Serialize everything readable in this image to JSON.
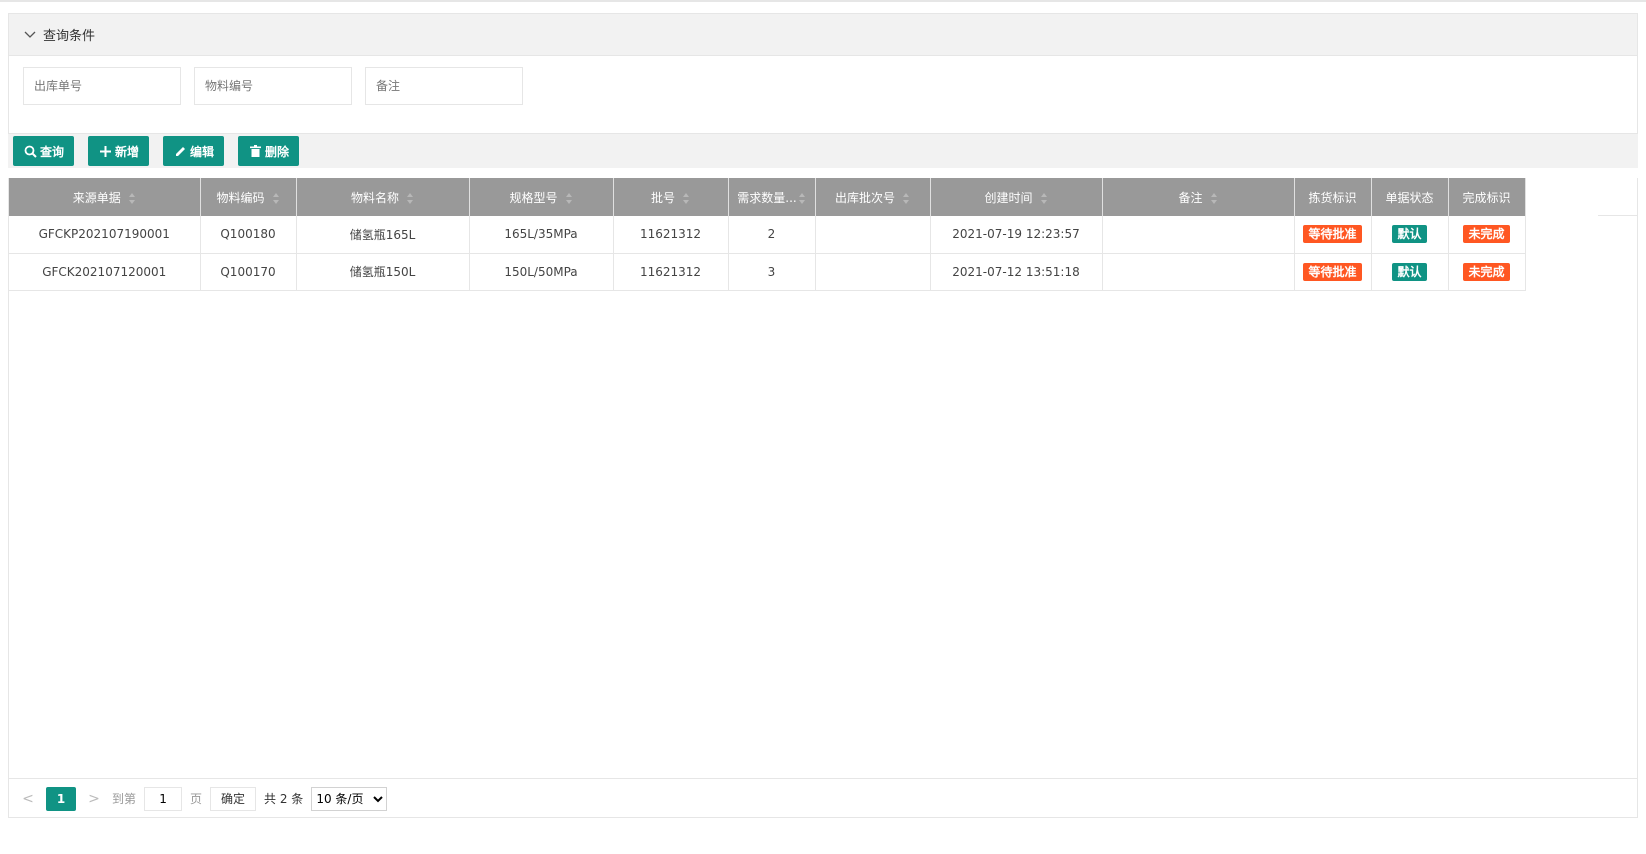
{
  "query": {
    "title": "查询条件",
    "fields": [
      {
        "placeholder": "出库单号",
        "value": ""
      },
      {
        "placeholder": "物料编号",
        "value": ""
      },
      {
        "placeholder": "备注",
        "value": ""
      }
    ]
  },
  "toolbar": {
    "query_label": "查询",
    "add_label": "新增",
    "edit_label": "编辑",
    "delete_label": "删除"
  },
  "table": {
    "columns": [
      "来源单据",
      "物料编码",
      "物料名称",
      "规格型号",
      "批号",
      "需求数量...",
      "出库批次号",
      "创建时间",
      "备注",
      "拣货标识",
      "单据状态",
      "完成标识"
    ],
    "rows": [
      {
        "source": "GFCKP202107190001",
        "code": "Q100180",
        "name": "储氢瓶165L",
        "spec": "165L/35MPa",
        "batch": "11621312",
        "qty": "2",
        "out_batch": "",
        "created": "2021-07-19 12:23:57",
        "remark": "",
        "pick": "等待批准",
        "status": "默认",
        "done": "未完成"
      },
      {
        "source": "GFCK202107120001",
        "code": "Q100170",
        "name": "储氢瓶150L",
        "spec": "150L/50MPa",
        "batch": "11621312",
        "qty": "3",
        "out_batch": "",
        "created": "2021-07-12 13:51:18",
        "remark": "",
        "pick": "等待批准",
        "status": "默认",
        "done": "未完成"
      }
    ]
  },
  "pager": {
    "prev": "<",
    "current": "1",
    "next": ">",
    "goto_label": "到第",
    "goto_value": "1",
    "page_label": "页",
    "confirm_label": "确定",
    "total": "共 2 条",
    "page_size": "10 条/页",
    "page_size_options": [
      "10 条/页"
    ]
  },
  "colors": {
    "accent": "#109384",
    "warning": "#ff5722",
    "header_bg": "#999999"
  },
  "icons": {
    "collapse": "chevron-down-icon",
    "query": "search-icon",
    "add": "plus-icon",
    "edit": "pencil-icon",
    "delete": "trash-icon"
  }
}
